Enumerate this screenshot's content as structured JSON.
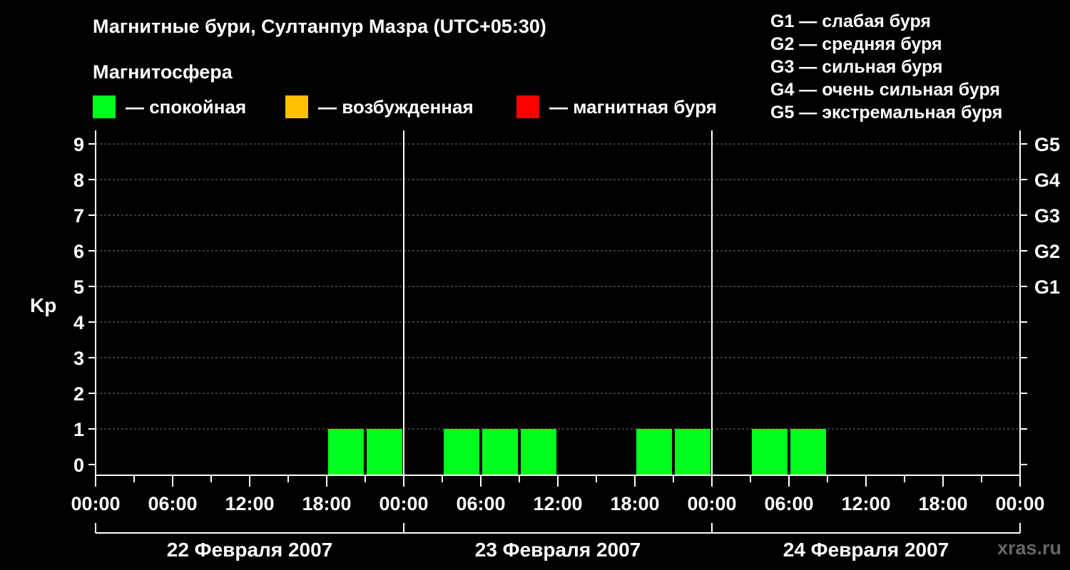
{
  "chart_data": {
    "type": "bar",
    "title": "Магнитные бури, Султанпур Мазра (UTC+05:30)",
    "subtitle": "Магнитосфера",
    "ylabel": "Kp",
    "ylim": [
      0,
      9
    ],
    "yticks": [
      "0",
      "1",
      "2",
      "3",
      "4",
      "5",
      "6",
      "7",
      "8",
      "9"
    ],
    "storm_levels": [
      {
        "kp": 5,
        "label": "G1"
      },
      {
        "kp": 6,
        "label": "G2"
      },
      {
        "kp": 7,
        "label": "G3"
      },
      {
        "kp": 8,
        "label": "G4"
      },
      {
        "kp": 9,
        "label": "G5"
      }
    ],
    "xticks": [
      "00:00",
      "06:00",
      "12:00",
      "18:00",
      "00:00",
      "06:00",
      "12:00",
      "18:00",
      "00:00",
      "06:00",
      "12:00",
      "18:00",
      "00:00"
    ],
    "days": [
      "22 Февраля 2007",
      "23 Февраля 2007",
      "24 Февраля 2007"
    ],
    "values": [
      0,
      0,
      0,
      0,
      0,
      0,
      1,
      1,
      0,
      1,
      1,
      1,
      0,
      0,
      1,
      1,
      0,
      1,
      1,
      0,
      0,
      0,
      0,
      0
    ],
    "interval_hours": 3,
    "grid": true,
    "colors": {
      "quiet": "#00ff1e",
      "active": "#ffc000",
      "storm": "#ff0000"
    }
  },
  "legend": {
    "quiet": "— спокойная",
    "active": "— возбужденная",
    "storm": "— магнитная буря"
  },
  "g_legend": [
    "G1 — слабая буря",
    "G2 — средняя буря",
    "G3 — сильная буря",
    "G4 — очень сильная буря",
    "G5 — экстремальная буря"
  ],
  "watermark": "xras.ru"
}
